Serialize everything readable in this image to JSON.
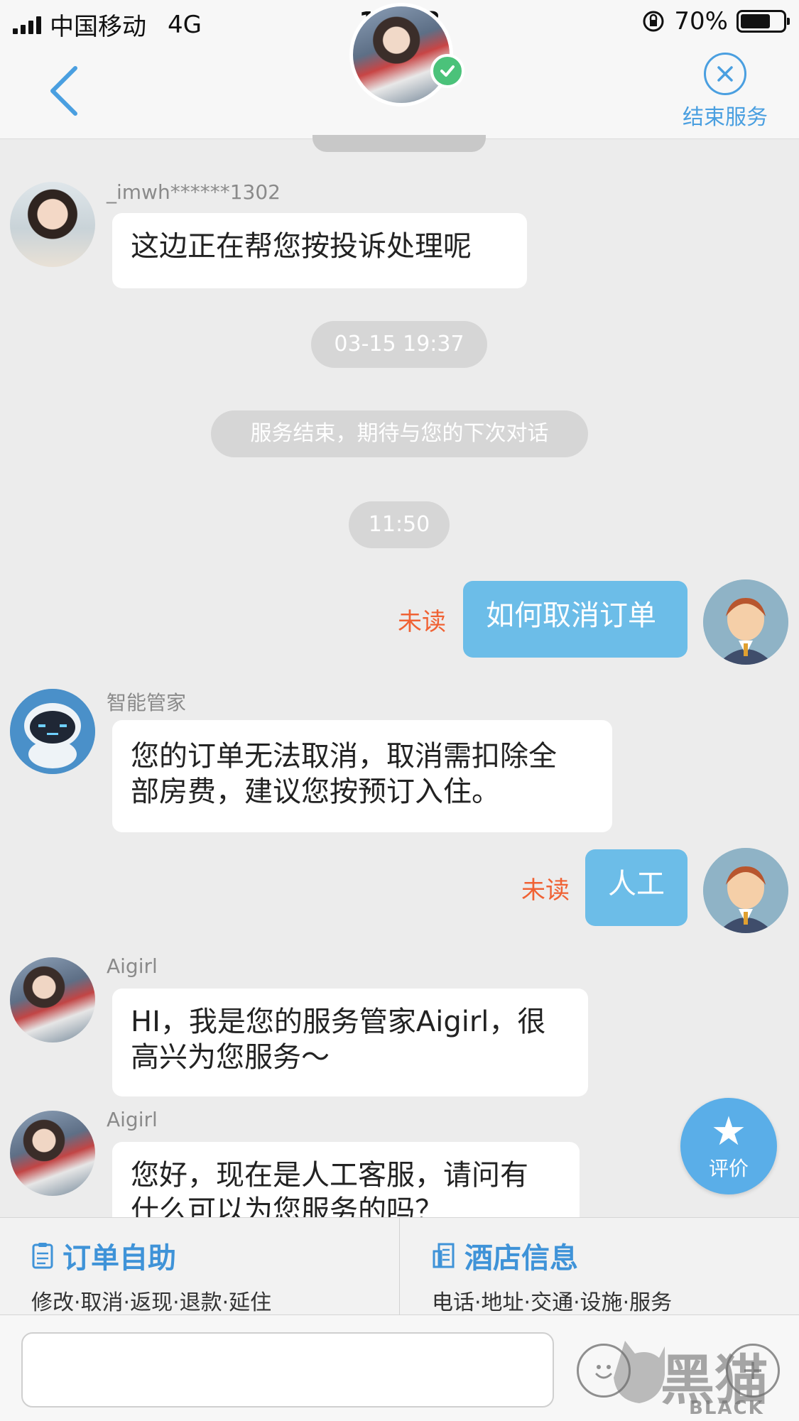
{
  "status_bar": {
    "carrier": "中国移动",
    "network": "4G",
    "time": "12:58",
    "battery": "70%"
  },
  "header": {
    "end_service_label": "结束服务"
  },
  "messages": {
    "m1_sender": "_imwh******1302",
    "m1_text": "这边正在帮您按投诉处理呢",
    "time1": "03-15 19:37",
    "system_notice": "服务结束，期待与您的下次对话",
    "time2": "11:50",
    "m2_status": "未读",
    "m2_text": "如何取消订单",
    "m3_sender": "智能管家",
    "m3_line1": "您的订单无法取消，取消需扣除全",
    "m3_line2": "部房费，建议您按预订入住。",
    "m4_status": "未读",
    "m4_text": "人工",
    "m5_sender": "Aigirl",
    "m5_line1": "HI，我是您的服务管家Aigirl，很",
    "m5_line2": "高兴为您服务～",
    "m6_sender": "Aigirl",
    "m6_line1": "您好，现在是人工客服，请问有",
    "m6_line2": "什么可以为您服务的吗？"
  },
  "rate_button": {
    "label": "评价"
  },
  "service_panel": {
    "order_title": "订单自助",
    "order_sub": "修改·取消·返现·退款·延住",
    "hotel_title": "酒店信息",
    "hotel_sub": "电话·地址·交通·设施·服务"
  },
  "watermark": {
    "text_cn": "黑猫",
    "text_en": "BLACK CAT"
  },
  "colors": {
    "accent": "#4a9fe0",
    "self_bubble": "#6cbde8",
    "unread": "#f06234"
  },
  "icons": [
    "back-chevron-icon",
    "verified-check-icon",
    "close-circle-icon",
    "star-icon",
    "document-icon",
    "building-icon",
    "emoji-icon",
    "plus-icon"
  ]
}
